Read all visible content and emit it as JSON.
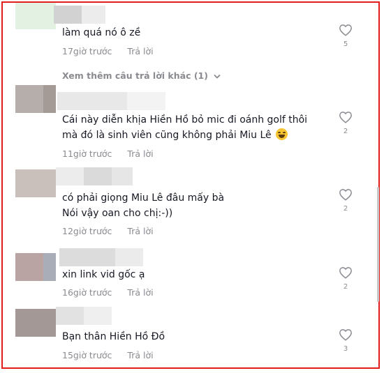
{
  "comments_top": {
    "text": "làm quá nó ô zề",
    "time": "17giờ trước",
    "reply": "Trả lời",
    "likes": "5"
  },
  "view_more": "Xem thêm câu trả lời khác (1)",
  "comments": [
    {
      "text": "Cái này diễn khịa Hiền Hồ bỏ mic đi oánh golf thôi\nmà đó là sinh viên cũng không phải Miu Lê",
      "emoji": "face-with-tears-of-joy",
      "time": "11giờ trước",
      "reply": "Trả lời",
      "likes": "2"
    },
    {
      "text": "có phải giọng Miu Lê đâu mấy bà\nNói vậy oan cho chị:-))",
      "time": "12giờ trước",
      "reply": "Trả lời",
      "likes": "2"
    },
    {
      "text": "xin link vid gốc ạ",
      "time": "16giờ trước",
      "reply": "Trả lời",
      "likes": "2"
    },
    {
      "text": "Bạn thân Hiền Hồ Đồ",
      "time": "15giờ trước",
      "reply": "Trả lời",
      "likes": "3"
    }
  ],
  "colors": {
    "border": "#e21b1b",
    "muted": "#8a8b91",
    "text": "#161823"
  }
}
